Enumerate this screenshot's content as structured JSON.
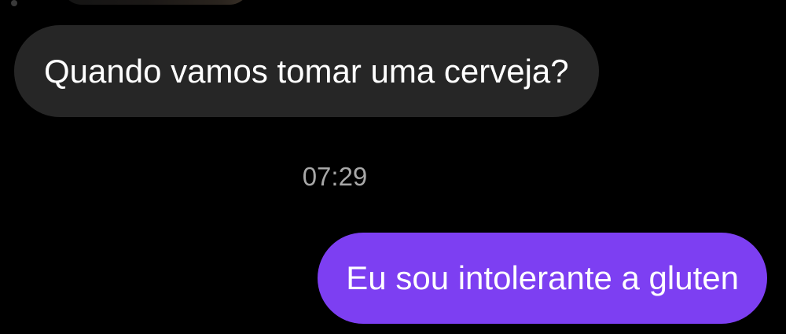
{
  "conversation": {
    "messages": [
      {
        "direction": "incoming",
        "text": "Quando vamos tomar uma cerveja?"
      },
      {
        "direction": "outgoing",
        "text": "Eu sou intolerante a gluten"
      }
    ],
    "timestamp": "07:29"
  },
  "colors": {
    "background": "#000000",
    "incoming_bubble": "#262626",
    "outgoing_bubble": "#7d3ff2",
    "timestamp_text": "#a8a8a8",
    "message_text": "#ffffff"
  }
}
